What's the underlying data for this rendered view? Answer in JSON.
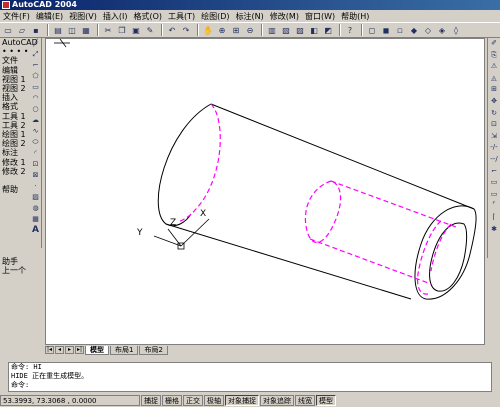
{
  "window": {
    "title": "AutoCAD 2004"
  },
  "menu": [
    "文件(F)",
    "编辑(E)",
    "视图(V)",
    "插入(I)",
    "格式(O)",
    "工具(T)",
    "绘图(D)",
    "标注(N)",
    "修改(M)",
    "窗口(W)",
    "帮助(H)"
  ],
  "toolbar_icons": [
    "new-icon",
    "open-icon",
    "save-icon",
    "print-icon",
    "preview-icon",
    "plot-icon",
    "cut-icon",
    "copy-icon",
    "paste-icon",
    "matchprop-icon",
    "undo-icon",
    "redo-icon",
    "pan-icon",
    "zoom-realtime-icon",
    "zoom-window-icon",
    "zoom-previous-icon",
    "properties-icon",
    "designcenter-icon",
    "toolpalette-icon",
    "dbconnect-icon",
    "markup-icon",
    "help-icon",
    "view-top-icon",
    "view-front-icon",
    "view-left-icon",
    "view-iso-icon"
  ],
  "left_panel": {
    "title": "AutoCAD",
    "dots": "• • • •",
    "items": [
      "文件",
      "编辑",
      "视图 1",
      "视图 2",
      "插入",
      "格式",
      "工具 1",
      "工具 2",
      "绘图 1",
      "绘图 2",
      "标注",
      "修改 1",
      "修改 2",
      "",
      "帮助",
      "",
      "",
      "",
      "",
      "",
      "",
      "",
      "助手",
      "上一个"
    ]
  },
  "tabs": {
    "items": [
      "模型",
      "布局1",
      "布局2"
    ],
    "active": "模型"
  },
  "command": {
    "lines": [
      "命令:  HI",
      "HIDE 正在重生成模型。",
      "命令:"
    ]
  },
  "status": {
    "coords": "53.3993,  73.3068 , 0.0000",
    "buttons": [
      {
        "label": "捕捉",
        "on": false
      },
      {
        "label": "栅格",
        "on": false
      },
      {
        "label": "正交",
        "on": false
      },
      {
        "label": "极轴",
        "on": false
      },
      {
        "label": "对象捕捉",
        "on": true
      },
      {
        "label": "对象追踪",
        "on": false
      },
      {
        "label": "线宽",
        "on": false
      },
      {
        "label": "模型",
        "on": true
      }
    ]
  },
  "ucs": {
    "x": "X",
    "y": "Y",
    "z": "Z"
  },
  "colors": {
    "hidden_lines": "#ff00ff",
    "edges": "#000000"
  }
}
